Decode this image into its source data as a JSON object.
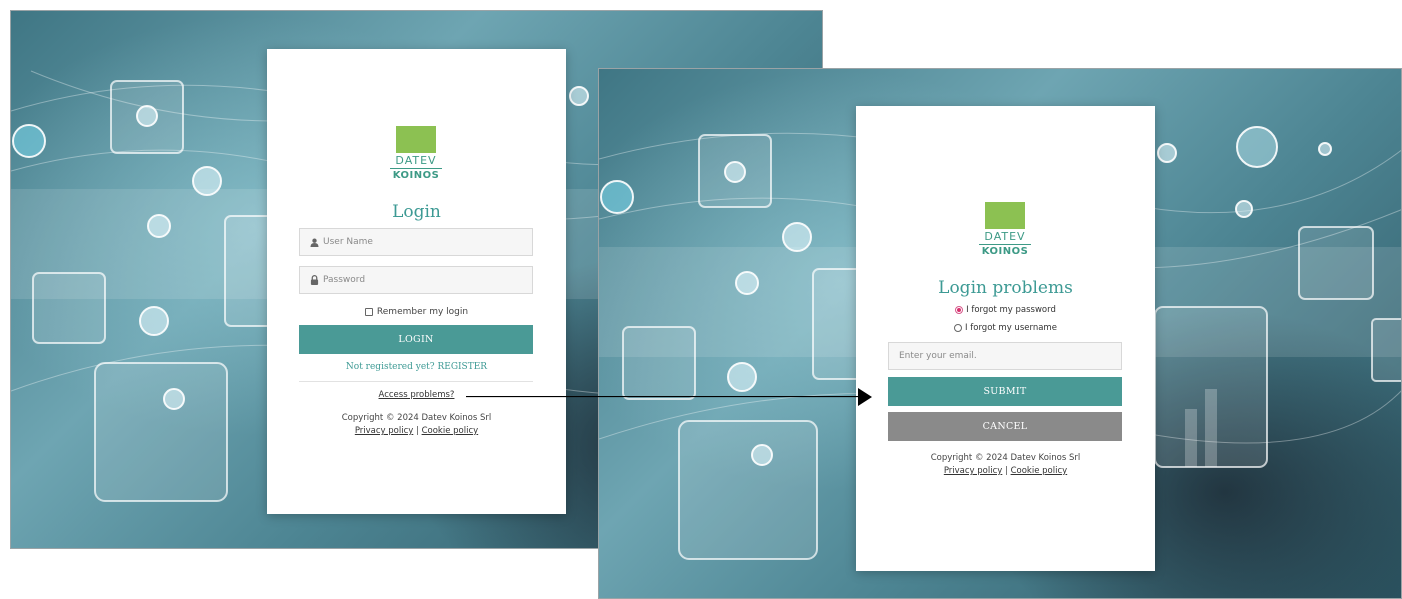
{
  "login_screen": {
    "logo": {
      "brand_top": "DATEV",
      "brand_bottom": "KOINOS"
    },
    "title": "Login",
    "username": {
      "placeholder": "User Name",
      "icon": "user-icon"
    },
    "password": {
      "placeholder": "Password",
      "icon": "lock-icon"
    },
    "remember_label": "Remember my login",
    "login_button": "LOGIN",
    "register_link": "Not registered yet? REGISTER",
    "access_problems_link": "Access problems?",
    "copyright": "Copyright © 2024 Datev Koinos Srl",
    "privacy_link": "Privacy policy",
    "cookie_link": "Cookie policy",
    "link_separator": "|"
  },
  "problems_screen": {
    "logo": {
      "brand_top": "DATEV",
      "brand_bottom": "KOINOS"
    },
    "title": "Login problems",
    "options": [
      {
        "label": "I forgot my password",
        "selected": true
      },
      {
        "label": "I forgot my username",
        "selected": false
      }
    ],
    "email": {
      "placeholder": "Enter your email."
    },
    "submit_button": "SUBMIT",
    "cancel_button": "CANCEL",
    "copyright": "Copyright © 2024 Datev Koinos Srl",
    "privacy_link": "Privacy policy",
    "cookie_link": "Cookie policy",
    "link_separator": "|"
  },
  "colors": {
    "accent": "#4a9a96",
    "title": "#3d9a94",
    "logo_green": "#8cc152",
    "cancel": "#8a8a8a",
    "radio_selected": "#d8326e"
  }
}
